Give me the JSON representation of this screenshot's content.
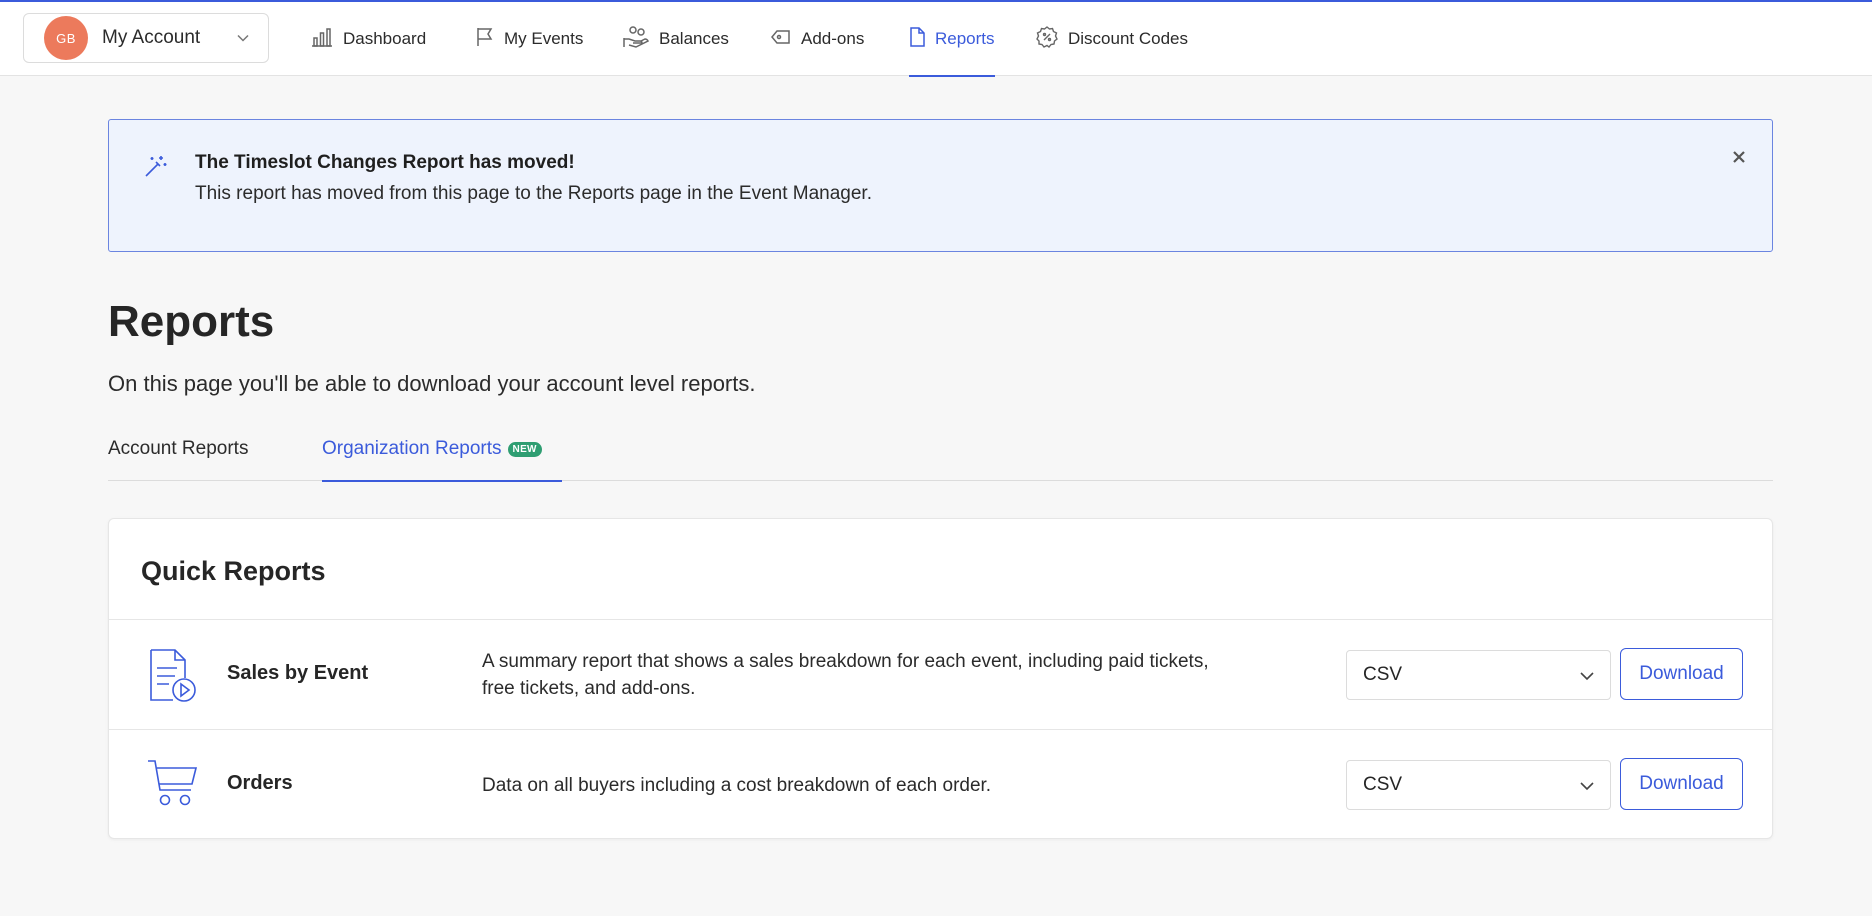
{
  "nav": {
    "avatar_initials": "GB",
    "account_label": "My Account",
    "items": [
      {
        "label": "Dashboard",
        "icon": "bar-chart-icon"
      },
      {
        "label": "My Events",
        "icon": "flag-icon"
      },
      {
        "label": "Balances",
        "icon": "hand-coins-icon"
      },
      {
        "label": "Add-ons",
        "icon": "tag-icon"
      },
      {
        "label": "Reports",
        "icon": "document-icon"
      },
      {
        "label": "Discount Codes",
        "icon": "discount-badge-icon"
      }
    ],
    "active": "Reports"
  },
  "banner": {
    "title": "The Timeslot Changes Report has moved!",
    "text": "This report has moved from this page to the Reports page in the Event Manager."
  },
  "page": {
    "title": "Reports",
    "subtitle": "On this page you'll be able to download your account level reports."
  },
  "tabs": {
    "account": "Account Reports",
    "organization": "Organization Reports",
    "new_badge": "NEW",
    "active": "Organization Reports"
  },
  "quick_reports": {
    "title": "Quick Reports",
    "rows": [
      {
        "name": "Sales by Event",
        "description": "A summary report that shows a sales breakdown for each event, including paid tickets, free tickets, and add-ons.",
        "format": "CSV",
        "button": "Download"
      },
      {
        "name": "Orders",
        "description": "Data on all buyers including a cost breakdown of each order.",
        "format": "CSV",
        "button": "Download"
      }
    ]
  },
  "colors": {
    "accent": "#3b5bdb",
    "avatar": "#ec7a5c",
    "badge": "#2f9e72",
    "banner_bg": "#eef3fd"
  }
}
